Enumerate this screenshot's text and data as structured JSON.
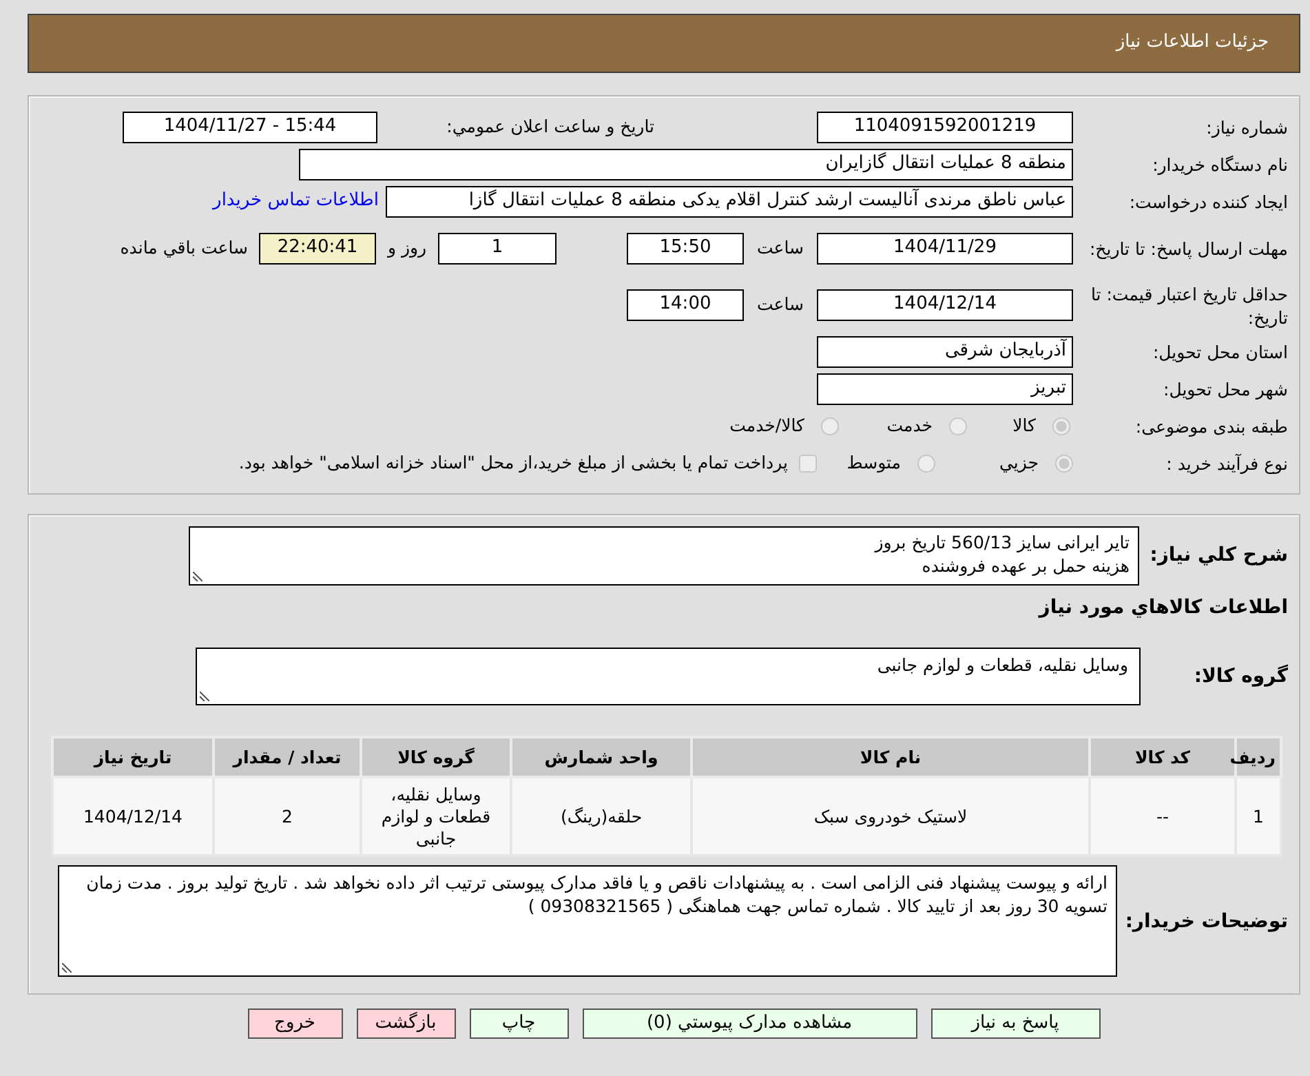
{
  "header": {
    "title": "جزئیات اطلاعات نیاز"
  },
  "details": {
    "need_number": {
      "label": "شماره نیاز:",
      "value": "1104091592001219"
    },
    "announce_date": {
      "label": "تاریخ و ساعت اعلان عمومي:",
      "value": "1404/11/27 - 15:44"
    },
    "buyer_org": {
      "label": "نام دستگاه خریدار:",
      "value": "منطقه 8 عملیات انتقال گازایران"
    },
    "requester": {
      "label": "ایجاد کننده درخواست:",
      "value": "عباس ناطق مرندی آنالیست ارشد کنترل اقلام یدکی منطقه 8 عملیات انتقال گازا",
      "link": "اطلاعات تماس خریدار"
    },
    "deadline": {
      "label": "مهلت ارسال پاسخ: تا تاریخ:",
      "date": "1404/11/29",
      "time_label": "ساعت",
      "time": "15:50",
      "days": "1",
      "days_label": "روز و",
      "remaining": "22:40:41",
      "remaining_label": "ساعت باقي مانده"
    },
    "validity": {
      "label": "حداقل تاریخ اعتبار قیمت: تا تاریخ:",
      "date": "1404/12/14",
      "time_label": "ساعت",
      "time": "14:00"
    },
    "province": {
      "label": "استان محل تحویل:",
      "value": "آذربایجان شرقی"
    },
    "city": {
      "label": "شهر محل تحویل:",
      "value": "تبریز"
    },
    "category": {
      "label": "طبقه بندی موضوعی:",
      "options": [
        {
          "label": "کالا",
          "selected": true
        },
        {
          "label": "خدمت",
          "selected": false
        },
        {
          "label": "کالا/خدمت",
          "selected": false
        }
      ]
    },
    "process": {
      "label": "نوع فرآیند خرید :",
      "options": [
        {
          "label": "جزيي",
          "selected": true
        },
        {
          "label": "متوسط",
          "selected": false
        }
      ],
      "treasury": {
        "label": "پرداخت تمام یا بخشی از مبلغ خرید،از محل \"اسناد خزانه اسلامی\" خواهد بود.",
        "checked": false
      }
    }
  },
  "need": {
    "label": "شرح کلي نیاز:",
    "text": "تایر ایرانی سایز 560/13 تاریخ بروز\nهزینه حمل بر عهده فروشنده"
  },
  "goods": {
    "title": "اطلاعات کالاهاي مورد نیاز",
    "group_label": "گروه کالا:",
    "group": "وسایل نقلیه، قطعات و لوازم جانبی"
  },
  "items_table": {
    "columns": [
      "ردیف",
      "کد کالا",
      "نام کالا",
      "واحد شمارش",
      "گروه کالا",
      "تعداد / مقدار",
      "تاریخ نیاز"
    ],
    "rows": [
      [
        "1",
        "--",
        "لاستیک خودروی سبک",
        "حلقه(رینگ)",
        "وسایل نقلیه، قطعات و لوازم جانبی",
        "2",
        "1404/12/14"
      ]
    ]
  },
  "buyer_notes": {
    "label": "توضیحات خریدار:",
    "text": "ارائه و پیوست پیشنهاد فنی الزامی است . به پیشنهادات ناقص و یا فاقد مدارک پیوستی ترتیب اثر داده نخواهد شد . تاریخ تولید بروز . مدت زمان تسویه 30 روز بعد از تایید کالا . شماره تماس جهت هماهنگی ( 09308321565 )"
  },
  "buttons": [
    {
      "label": "پاسخ به نیاز",
      "kind": "normal"
    },
    {
      "label": "مشاهده مدارک پیوستي (0)",
      "kind": "normal"
    },
    {
      "label": "چاپ",
      "kind": "normal"
    },
    {
      "label": "بازگشت",
      "kind": "alert"
    },
    {
      "label": "خروج",
      "kind": "alert"
    }
  ]
}
